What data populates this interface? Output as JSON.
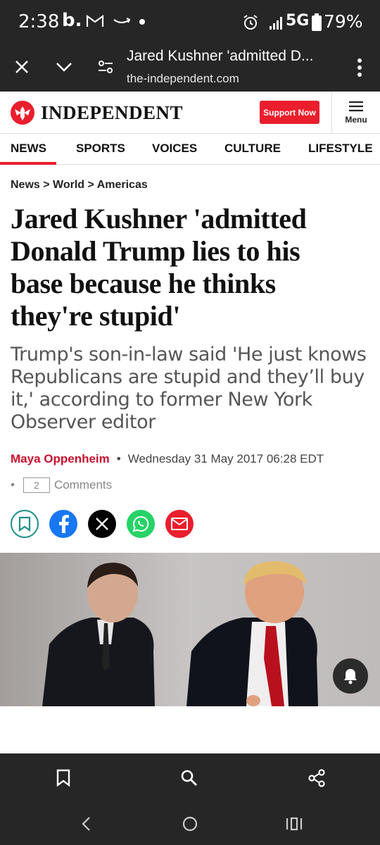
{
  "status_bar": {
    "time": "2:38",
    "brand_letter": "b.",
    "network": "5G",
    "battery": "79%",
    "icons": [
      "gmail-icon",
      "amazon-icon",
      "alarm-icon",
      "signal-icon",
      "battery-icon"
    ]
  },
  "browser": {
    "page_title": "Jared Kushner 'admitted D...",
    "url": "the-independent.com"
  },
  "site": {
    "logo_text": "INDEPENDENT",
    "support_label": "Support Now",
    "menu_label": "Menu",
    "brand_color": "#ea1e2d"
  },
  "nav": {
    "items": [
      "NEWS",
      "SPORTS",
      "VOICES",
      "CULTURE",
      "LIFESTYLE"
    ],
    "active": "NEWS"
  },
  "article": {
    "breadcrumb": "News > World > Americas",
    "headline_lines": [
      "Jared Kushner 'admitted",
      "Donald Trump lies to his",
      "base because he thinks",
      "they're stupid'"
    ],
    "standfirst_lines": [
      "Trump's son-in-law said 'He just knows",
      "Republicans are stupid and they’ll buy",
      "it,' according to former New York",
      "Observer editor"
    ],
    "author": "Maya Oppenheim",
    "bullet": "•",
    "date": "Wednesday 31 May 2017 06:28 EDT",
    "comment_count": "2",
    "comments_label": "Comments"
  },
  "share_buttons": [
    {
      "name": "bookmark",
      "color": "#1d8f8a"
    },
    {
      "name": "facebook",
      "color": "#1877f2"
    },
    {
      "name": "x",
      "color": "#000000"
    },
    {
      "name": "whatsapp",
      "color": "#25d366"
    },
    {
      "name": "email",
      "color": "#ea1e2d"
    }
  ]
}
